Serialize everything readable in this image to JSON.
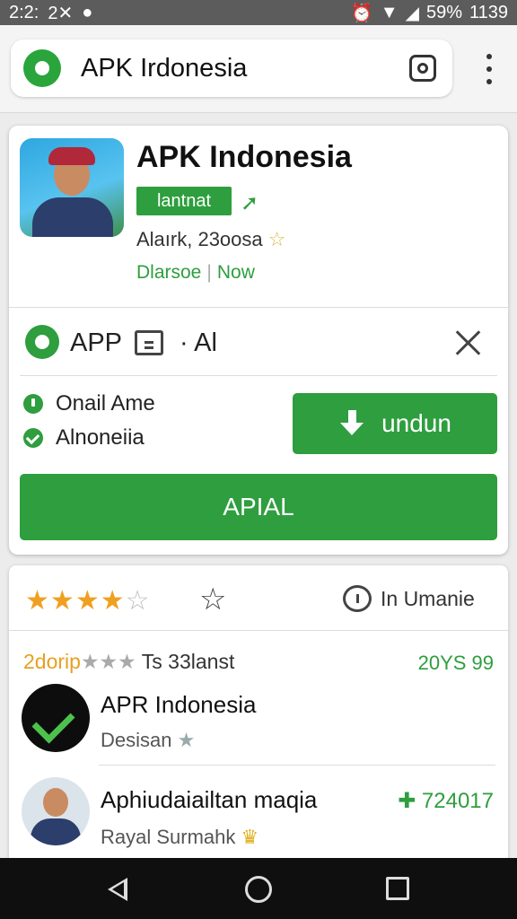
{
  "status_bar": {
    "time": "2:2:",
    "icons_left": "2✕",
    "battery": "59%",
    "clock_right": "1139"
  },
  "browser": {
    "title": "APK Irdonesia"
  },
  "app_card": {
    "title": "APK Indonesia",
    "tag": "lantnat",
    "meta": "Alaırk, 23oosa",
    "link_left": "Dlarsoe",
    "link_right": "Now",
    "row_label_app": "APP",
    "row_label_ai": "· Al",
    "info_1": "Onail Ame",
    "info_2": "Alnoneiia",
    "download_label": "undun",
    "install_label": "APIAL"
  },
  "review_card": {
    "rating": 4,
    "comment_label": "In Umanie",
    "review_prefix": "2dorip",
    "review_suffix": "Ts 33lanst",
    "review_count": "20YS 99",
    "items": [
      {
        "title": "APR Indonesia",
        "subtitle": "Desisan",
        "right": ""
      },
      {
        "title": "Aphiudaiailtan maqia",
        "subtitle": "Rayal Surmahk",
        "right": "724017"
      }
    ]
  },
  "colors": {
    "accent": "#2e9e3e",
    "star": "#f0a020",
    "status_bar": "#5c5c5c",
    "nav_bar": "#0f0f0f"
  },
  "icons": [
    "app-logo-icon",
    "camera-icon",
    "more-vert-icon",
    "share-icon",
    "star-icon",
    "gear-icon",
    "document-icon",
    "close-icon",
    "info-icon",
    "check-icon",
    "download-icon",
    "star-outline-icon",
    "comment-icon",
    "back-icon",
    "home-icon",
    "recents-icon"
  ]
}
